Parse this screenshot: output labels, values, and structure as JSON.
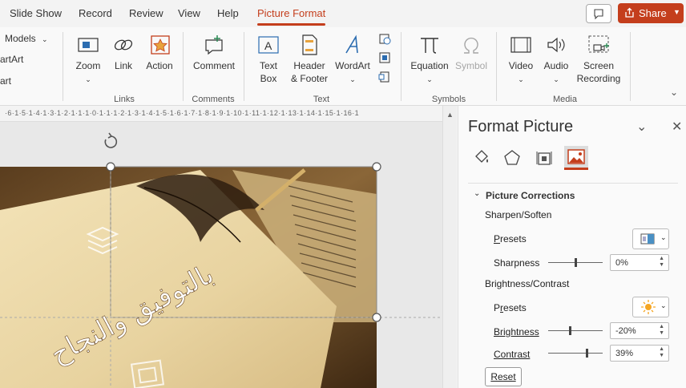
{
  "menu": {
    "tabs": [
      "Slide Show",
      "Record",
      "Review",
      "View",
      "Help",
      "Picture Format"
    ],
    "share_label": "Share"
  },
  "ribbon": {
    "left_items": [
      "Models",
      "artArt",
      "art"
    ],
    "buttons": {
      "zoom": "Zoom",
      "link": "Link",
      "action": "Action",
      "comment": "Comment",
      "textbox_1": "Text",
      "textbox_2": "Box",
      "header_1": "Header",
      "header_2": "& Footer",
      "wordart": "WordArt",
      "equation": "Equation",
      "symbol": "Symbol",
      "video": "Video",
      "audio": "Audio",
      "screen_1": "Screen",
      "screen_2": "Recording"
    },
    "groups": {
      "links": "Links",
      "comments": "Comments",
      "text": "Text",
      "symbols": "Symbols",
      "media": "Media"
    }
  },
  "ruler": {
    "marks": "·6·1·5·1·4·1·3·1·2·1·1·1·0·1·1·1·2·1·3·1·4·1·5·1·6·1·7·1·8·1·9·1·10·1·11·1·12·1·13·1·14·1·15·1·16·1"
  },
  "slide": {
    "arabic_text": "بالتوفيق والنجاح"
  },
  "pane": {
    "title": "Format Picture",
    "section": "Picture Corrections",
    "sharpen_label": "Sharpen/Soften",
    "presets_label": "Presets",
    "sharpness_label": "Sharpness",
    "sharpness_value": "0%",
    "sharpness_level": 0.5,
    "brightness_contrast_label": "Brightness/Contrast",
    "brightness_label": "Brightness",
    "brightness_value": "-20%",
    "brightness_level": 0.4,
    "contrast_label": "Contrast",
    "contrast_value": "39%",
    "contrast_level": 0.7,
    "reset_label": "Reset"
  },
  "colors": {
    "accent": "#c43e1c"
  }
}
